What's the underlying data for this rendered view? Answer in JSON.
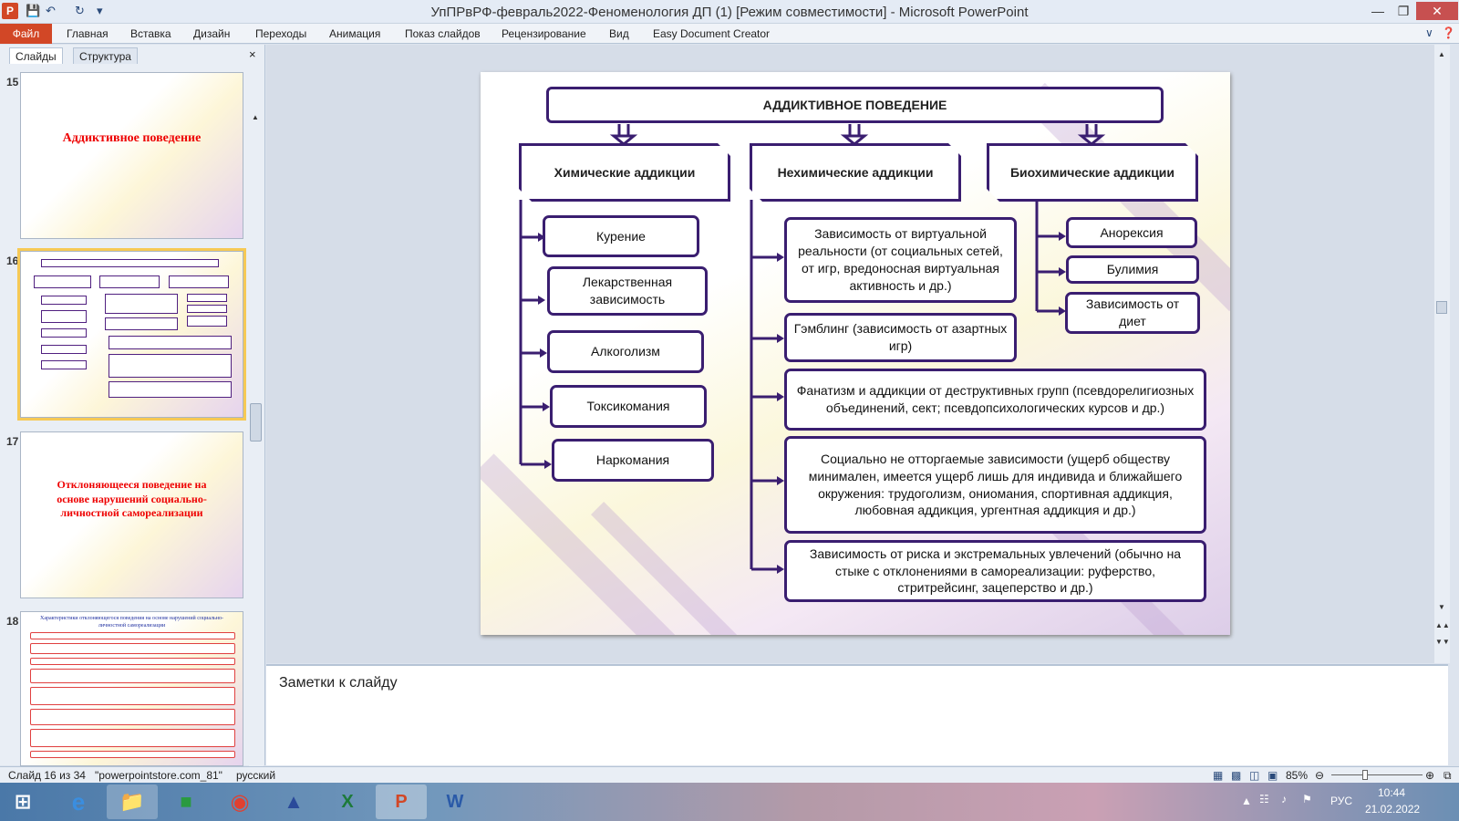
{
  "window": {
    "title": "УпПРвРФ-февраль2022-Феноменология ДП (1) [Режим совместимости]  -  Microsoft PowerPoint",
    "app_icon": "P",
    "qat_icons": [
      "save-icon",
      "undo-icon",
      "redo-icon",
      "customize-qat-icon"
    ]
  },
  "ribbon": {
    "file": "Файл",
    "tabs": [
      "Главная",
      "Вставка",
      "Дизайн",
      "Переходы",
      "Анимация",
      "Показ слайдов",
      "Рецензирование",
      "Вид",
      "Easy Document Creator"
    ]
  },
  "pane": {
    "tabs": [
      "Слайды",
      "Структура"
    ],
    "close": "×"
  },
  "thumbs": {
    "n15": "15",
    "t15": "Аддиктивное поведение",
    "n16": "16",
    "n17": "17",
    "t17": "Отклоняющееся поведение на основе нарушений социально-личностной самореализации",
    "n18": "18",
    "t18": "Характеристики отклоняющегося поведения на основе нарушений социально-личностной самореализации"
  },
  "slide": {
    "header": "АДДИКТИВНОЕ ПОВЕДЕНИЕ",
    "cat_chem": "Химические аддикции",
    "cat_nonchem": "Нехимические аддикции",
    "cat_biochem": "Биохимические аддикции",
    "chem": [
      "Курение",
      "Лекарственная зависимость",
      "Алкоголизм",
      "Токсикомания",
      "Наркомания"
    ],
    "nonchem": [
      "Зависимость от виртуальной реальности (от социальных сетей,    от игр, вредоносная виртуальная активность и др.)",
      "Гэмблинг (зависимость от азартных игр)",
      "Фанатизм и аддикции от деструктивных групп (псевдорелигиозных объединений, сект; псевдопсихологических курсов и др.)",
      "Социально не отторгаемые зависимости (ущерб обществу минимален, имеется ущерб лишь для индивида и ближайшего окружения:   трудоголизм, ониомания, спортивная аддикция, любовная аддикция, ургентная аддикция и др.)",
      "Зависимость от риска и экстремальных увлечений  (обычно на стыке с отклонениями в самореализации: руферство, стритрейсинг, зацеперство и др.)"
    ],
    "biochem": [
      "Анорексия",
      "Булимия",
      "Зависимость от диет"
    ]
  },
  "notes": {
    "placeholder": "Заметки к слайду"
  },
  "status": {
    "slide": "Слайд 16 из 34",
    "theme": "\"powerpointstore.com_81\"",
    "lang": "русский",
    "zoom": "85%",
    "zoom_level": 0.85
  },
  "taskbar": {
    "apps": [
      "start-button",
      "ie-icon",
      "explorer-icon",
      "store-icon",
      "chrome-icon",
      "app-icon",
      "excel-icon",
      "powerpoint-icon",
      "word-icon"
    ],
    "lang": "РУС",
    "time": "10:44",
    "date": "21.02.2022"
  },
  "colors": {
    "accent": "#d24726",
    "box_border": "#3a1e70",
    "thumb_title": "#ee0000"
  }
}
